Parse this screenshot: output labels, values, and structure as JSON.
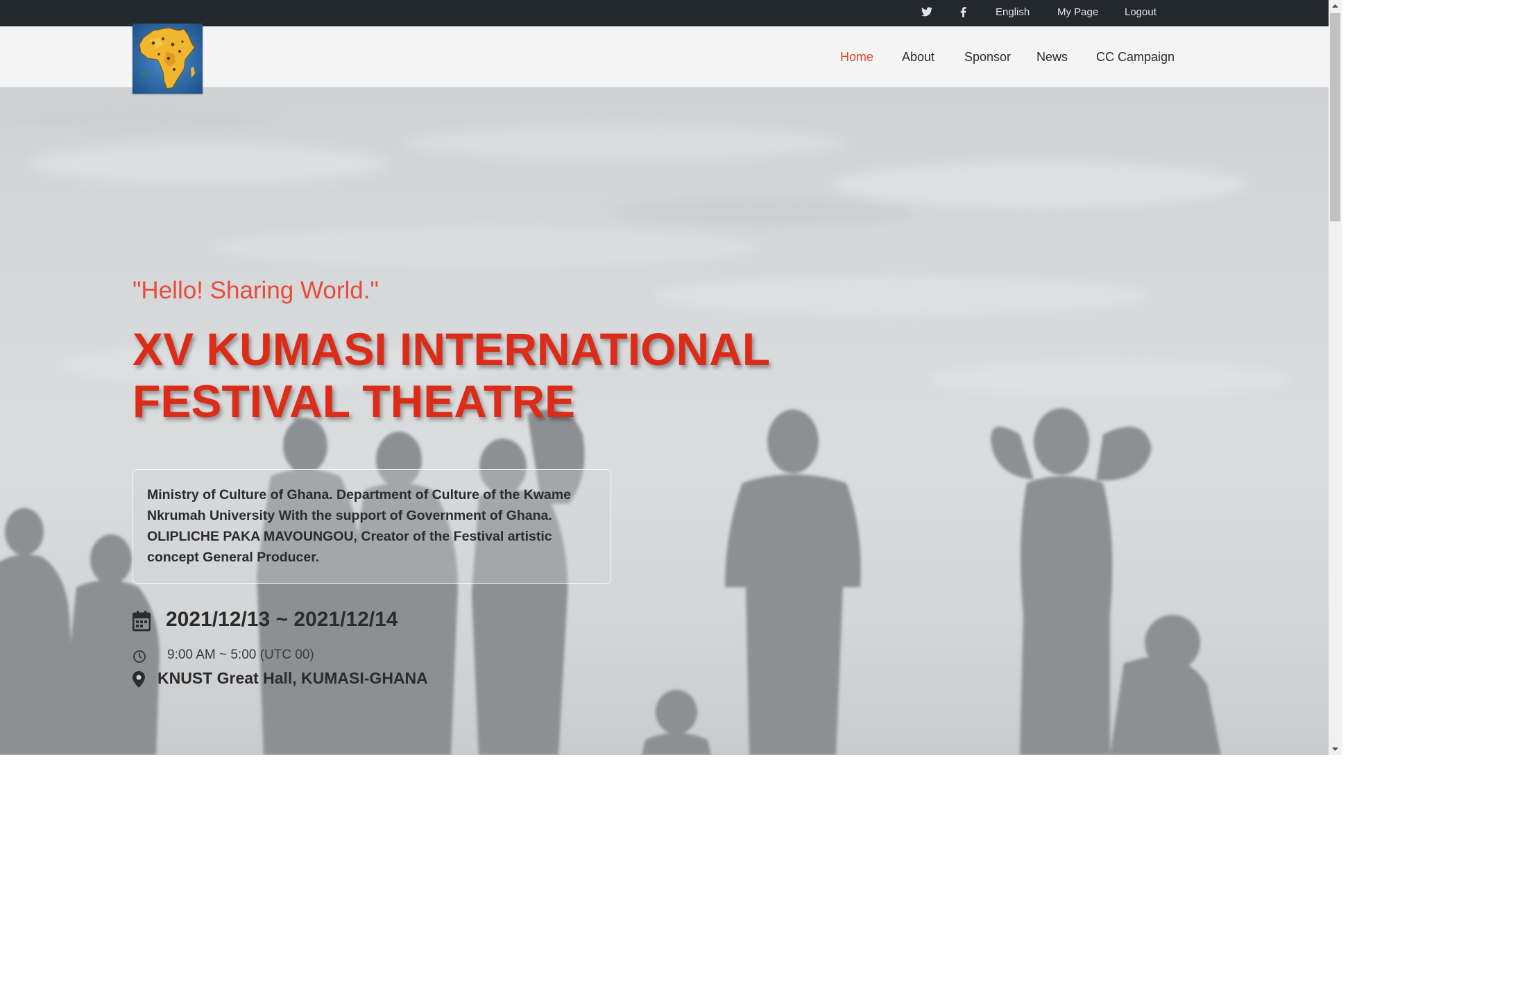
{
  "topbar": {
    "twitter_icon": "twitter-icon",
    "facebook_icon": "facebook-icon",
    "language": "English",
    "my_page": "My Page",
    "logout": "Logout"
  },
  "nav": {
    "logo_icon": "africa-map-logo",
    "items": [
      {
        "label": "Home",
        "active": true
      },
      {
        "label": "About",
        "active": false
      },
      {
        "label": "Sponsor",
        "active": false
      },
      {
        "label": "News",
        "active": false
      },
      {
        "label": "CC Campaign",
        "active": false
      }
    ]
  },
  "hero": {
    "tagline": "\"Hello! Sharing World.\"",
    "title_line1": "XV KUMASI INTERNATIONAL",
    "title_line2": "FESTIVAL THEATRE",
    "organizers": "Ministry of Culture of Ghana. Department of Culture of the Kwame Nkrumah University With the support of Government of Ghana. OLIPLICHE PAKA MAVOUNGOU, Creator of the Festival artistic concept General Producer.",
    "date": "2021/12/13 ~ 2021/12/14",
    "time": "9:00 AM ~ 5:00 (UTC 00)",
    "location": "KNUST Great Hall, KUMASI-GHANA",
    "date_icon": "calendar-icon",
    "time_icon": "clock-icon",
    "location_icon": "map-pin-icon"
  },
  "colors": {
    "accent": "#dc2b17",
    "tagline": "#e84c3a",
    "topbar_bg": "#23272e",
    "navbar_bg": "#f5f5f5"
  }
}
